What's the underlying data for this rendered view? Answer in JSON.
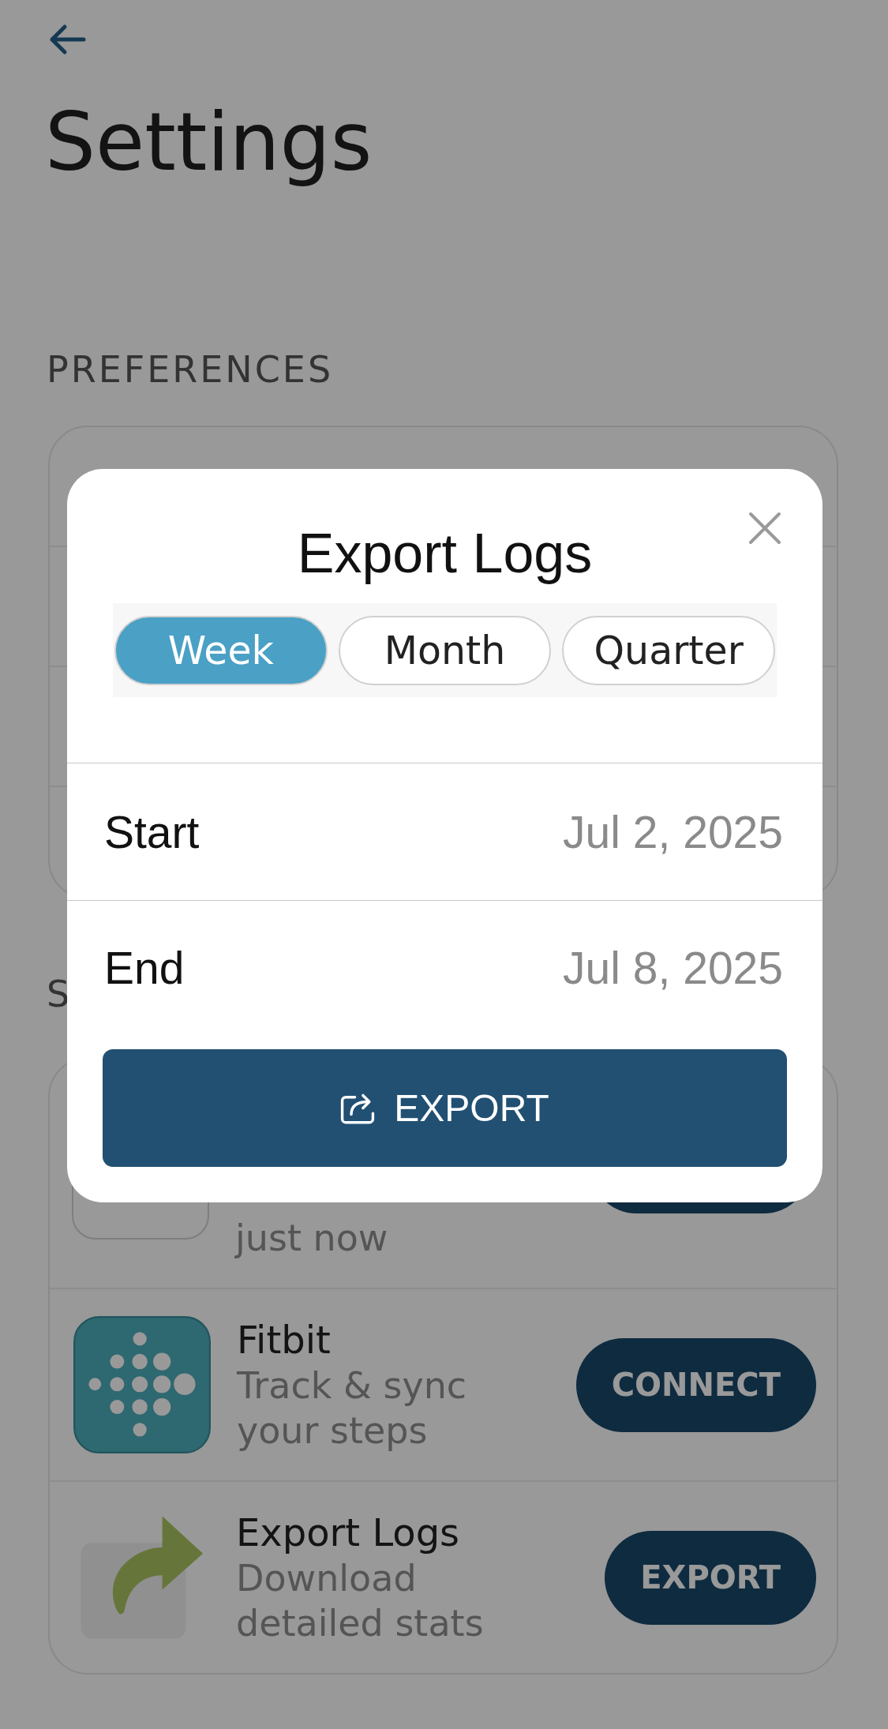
{
  "title": "Settings",
  "sections": [
    {
      "heading": "PREFERENCES"
    },
    {
      "heading": "S",
      "items": [
        {
          "kind": "covered",
          "description": "just now"
        },
        {
          "kind": "tracker",
          "title": "Fitbit",
          "description": "Track & sync your steps",
          "action": "CONNECT"
        },
        {
          "kind": "exporter",
          "title": "Export Logs",
          "description": "Download detailed stats",
          "action": "EXPORT"
        }
      ]
    }
  ],
  "modal": {
    "title": "Export Logs",
    "periods": [
      {
        "label": "Week",
        "selected": true
      },
      {
        "label": "Month",
        "selected": false
      },
      {
        "label": "Quarter",
        "selected": false
      }
    ],
    "fields": [
      {
        "label": "Start",
        "value": "Jul 2, 2025"
      },
      {
        "label": "End",
        "value": "Jul 8, 2025"
      }
    ],
    "button": "EXPORT"
  }
}
